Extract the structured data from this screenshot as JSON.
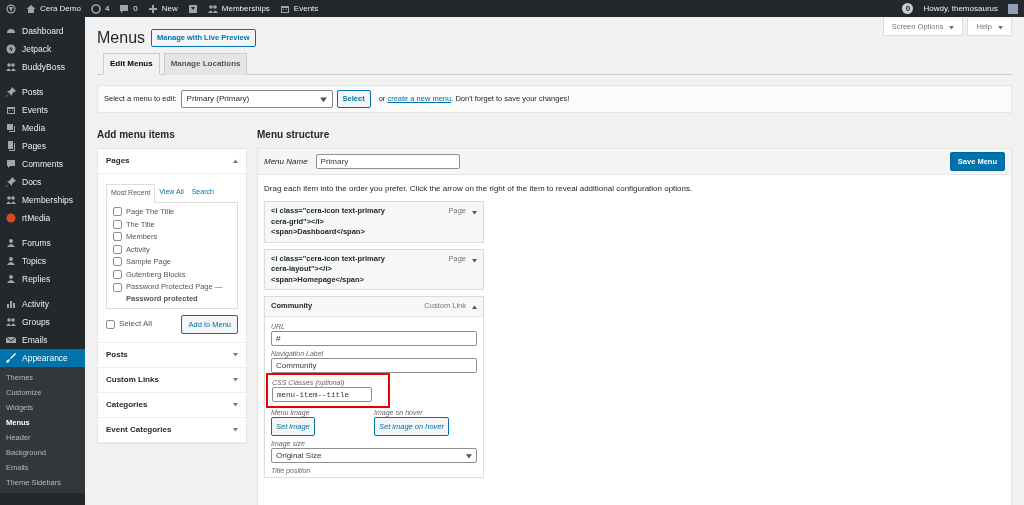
{
  "admin_bar": {
    "left": [
      {
        "kind": "wordpress"
      },
      {
        "kind": "home",
        "label": "Cera Demo"
      },
      {
        "kind": "updates",
        "label": "4"
      },
      {
        "kind": "comments",
        "label": "0"
      },
      {
        "kind": "plus",
        "label": "New"
      },
      {
        "kind": "yoast"
      },
      {
        "kind": "members",
        "label": "Memberships"
      },
      {
        "kind": "calendar",
        "label": "Events"
      }
    ],
    "notification_count": "0",
    "greeting": "Howdy, themosaurus"
  },
  "sidebar": [
    [
      {
        "label": "Dashboard",
        "kind": "gauge",
        "selected": false
      },
      {
        "label": "Jetpack",
        "kind": "bolt",
        "selected": false
      },
      {
        "label": "BuddyBoss",
        "kind": "people",
        "selected": false
      }
    ],
    [
      {
        "label": "Posts",
        "kind": "pin",
        "selected": false
      },
      {
        "label": "Events",
        "kind": "calendar",
        "selected": false
      },
      {
        "label": "Media",
        "kind": "media",
        "selected": false
      },
      {
        "label": "Pages",
        "kind": "page",
        "selected": false
      },
      {
        "label": "Comments",
        "kind": "bubble",
        "selected": false
      },
      {
        "label": "Docs",
        "kind": "pin",
        "selected": false
      },
      {
        "label": "Memberships",
        "kind": "people",
        "selected": false
      },
      {
        "label": "rtMedia",
        "kind": "dot",
        "selected": false
      }
    ],
    [
      {
        "label": "Forums",
        "kind": "forum",
        "selected": false
      },
      {
        "label": "Topics",
        "kind": "forum",
        "selected": false
      },
      {
        "label": "Replies",
        "kind": "forum",
        "selected": false
      }
    ],
    [
      {
        "label": "Activity",
        "kind": "activity",
        "selected": false
      },
      {
        "label": "Groups",
        "kind": "people",
        "selected": false
      },
      {
        "label": "Emails",
        "kind": "mail",
        "selected": false
      },
      {
        "label": "Appearance",
        "kind": "brush",
        "selected": true,
        "children": [
          {
            "label": "Themes",
            "selected": false
          },
          {
            "label": "Customize",
            "selected": false
          },
          {
            "label": "Widgets",
            "selected": false
          },
          {
            "label": "Menus",
            "selected": true
          },
          {
            "label": "Header",
            "selected": false
          },
          {
            "label": "Background",
            "selected": false
          },
          {
            "label": "Emails",
            "selected": false
          },
          {
            "label": "Theme Sidebars",
            "selected": false
          }
        ]
      }
    ]
  ],
  "screen_meta": [
    "Screen Options",
    "Help"
  ],
  "page_title": "Menus",
  "title_action": "Manage with Live Preview",
  "tabs": [
    {
      "label": "Edit Menus",
      "selected": true
    },
    {
      "label": "Manage Locations",
      "selected": false
    }
  ],
  "select_bar": {
    "label": "Select a menu to edit:",
    "value": "Primary (Primary)",
    "button": "Select",
    "before_link": "or",
    "link": "create a new menu",
    "after_link": ". Don't forget to save your changes!"
  },
  "add_items": {
    "heading": "Add menu items",
    "sections": [
      {
        "title": "Pages",
        "expanded": true,
        "tabs": [
          {
            "label": "Most Recent",
            "selected": true
          },
          {
            "label": "View All",
            "selected": false
          },
          {
            "label": "Search",
            "selected": false
          }
        ],
        "items": [
          {
            "label": "Page The Title",
            "checked": false
          },
          {
            "label": "The Title",
            "checked": false
          },
          {
            "label": "Members",
            "checked": false
          },
          {
            "label": "Activity",
            "checked": false
          },
          {
            "label": "Sample Page",
            "checked": false
          },
          {
            "label": "Gutenberg Blocks",
            "checked": false
          },
          {
            "label": "Password Protected Page — **Password protected**",
            "checked": false
          }
        ],
        "select_all": {
          "label": "Select All",
          "checked": false
        },
        "button": "Add to Menu"
      },
      {
        "title": "Posts",
        "expanded": false
      },
      {
        "title": "Custom Links",
        "expanded": false
      },
      {
        "title": "Categories",
        "expanded": false
      },
      {
        "title": "Event Categories",
        "expanded": false
      }
    ]
  },
  "structure": {
    "heading": "Menu structure",
    "name_label": "Menu Name",
    "name_value": "Primary",
    "save": "Save Menu",
    "instructions": "Drag each item into the order you prefer. Click the arrow on the right of the item to reveal additional configuration options.",
    "items": [
      {
        "title": "<i class=\"cera-icon text-primary\ncera-grid\"></i>\n<span>Dashboard</span>",
        "type": "Page",
        "expanded": false
      },
      {
        "title": "<i class=\"cera-icon text-primary\ncera-layout\"></i>\n<span>Homepage</span>",
        "type": "Page",
        "expanded": false
      },
      {
        "title": "Community",
        "type": "Custom Link",
        "expanded": true,
        "fields": [
          {
            "kind": "text",
            "label": "URL",
            "value": "#"
          },
          {
            "kind": "text",
            "label": "Navigation Label",
            "value": "Community"
          },
          {
            "kind": "code",
            "label": "CSS Classes (optional)",
            "value": "menu-item--title",
            "highlighted": true
          },
          {
            "kind": "buttons",
            "items": [
              {
                "label": "Menu image",
                "button": "Set image"
              },
              {
                "label": "Image on hover",
                "button": "Set image on hover"
              }
            ]
          },
          {
            "kind": "select",
            "label": "Image size",
            "value": "Original Size"
          },
          {
            "kind": "label",
            "label": "Title position"
          }
        ]
      }
    ]
  }
}
